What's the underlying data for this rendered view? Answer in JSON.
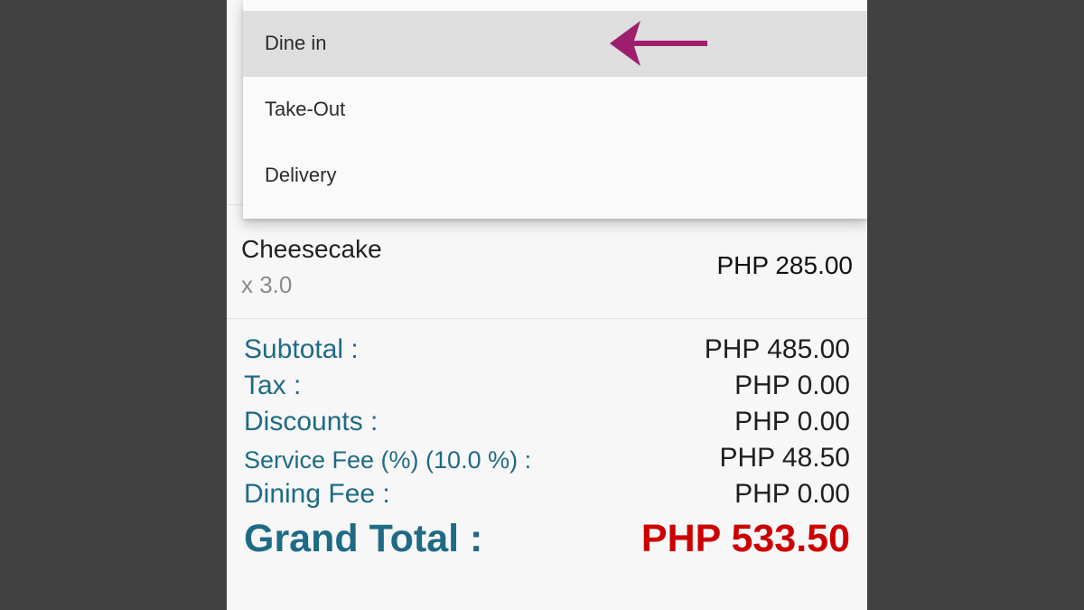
{
  "dropdown": {
    "options": [
      {
        "label": "Dine in",
        "selected": true
      },
      {
        "label": "Take-Out",
        "selected": false
      },
      {
        "label": "Delivery",
        "selected": false
      }
    ]
  },
  "annotation": {
    "color": "#9e1f6e",
    "icon": "arrow-left-icon"
  },
  "order_item": {
    "name": "Cheesecake",
    "quantity": "x 3.0",
    "price": "PHP 285.00"
  },
  "summary": {
    "subtotal": {
      "label": "Subtotal :",
      "value": "PHP 485.00"
    },
    "tax": {
      "label": "Tax :",
      "value": "PHP 0.00"
    },
    "discounts": {
      "label": "Discounts :",
      "value": "PHP 0.00"
    },
    "service_fee": {
      "label": "Service Fee (%) (10.0 %) :",
      "value": "PHP 48.50"
    },
    "dining_fee": {
      "label": "Dining Fee :",
      "value": "PHP 0.00"
    },
    "grand_total": {
      "label": "Grand Total :",
      "value": "PHP 533.50"
    }
  },
  "colors": {
    "label_teal": "#1e6b85",
    "grand_total_red": "#cc0000",
    "background_dark": "#414141"
  }
}
